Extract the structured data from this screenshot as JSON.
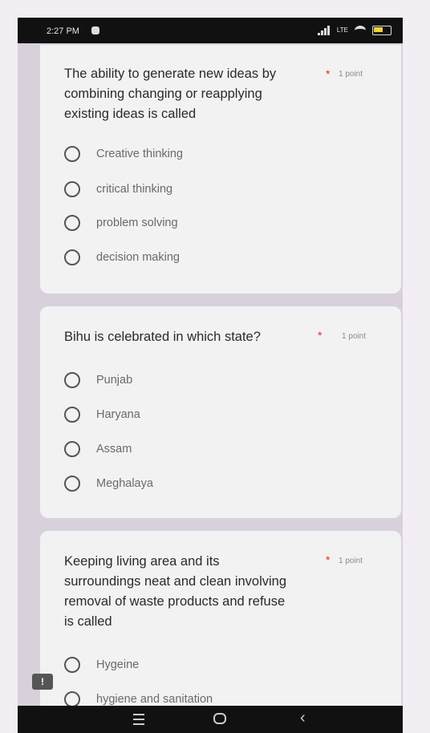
{
  "status_bar": {
    "time": "2:27 PM",
    "data_indicator": "LTE"
  },
  "questions": [
    {
      "title": "The ability to generate new ideas by combining changing or reapplying existing ideas is called",
      "required_mark": "*",
      "points": "1 point",
      "options": [
        "Creative thinking",
        "critical thinking",
        "problem solving",
        "decision making"
      ]
    },
    {
      "title": "Bihu is celebrated in which state?",
      "required_mark": "*",
      "points": "1 point",
      "options": [
        "Punjab",
        "Haryana",
        "Assam",
        "Meghalaya"
      ]
    },
    {
      "title": "Keeping living area and its surroundings neat and clean involving removal of waste products and refuse is called",
      "required_mark": "*",
      "points": "1 point",
      "options": [
        "Hygeine",
        "hygiene and sanitation"
      ]
    }
  ],
  "feedback_icon": "!",
  "nav": {
    "menu_icon": "menu-icon",
    "home_icon": "home-icon",
    "back_icon": "back-icon"
  }
}
